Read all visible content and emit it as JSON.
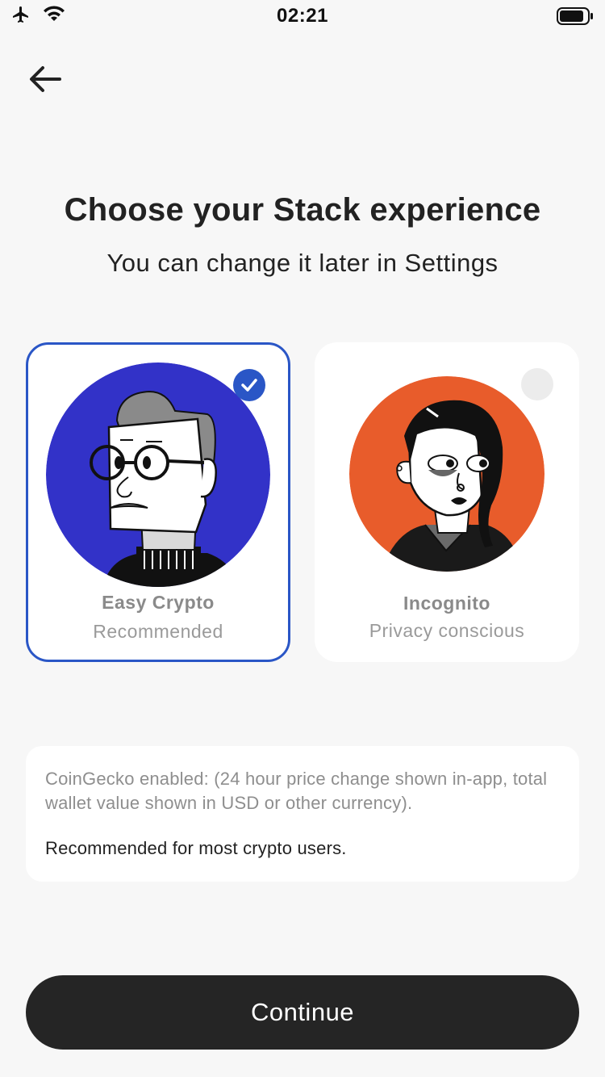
{
  "status_bar": {
    "time": "02:21",
    "icons": [
      "airplane-icon",
      "wifi-icon",
      "battery-icon"
    ]
  },
  "header": {
    "back_icon": "arrow-left-icon"
  },
  "main": {
    "title": "Choose your Stack experience",
    "subtitle": "You can change it later in Settings"
  },
  "options": [
    {
      "name": "Easy Crypto",
      "description": "Recommended",
      "selected": true,
      "avatar_color": "#3232c8"
    },
    {
      "name": "Incognito",
      "description": "Privacy conscious",
      "selected": false,
      "avatar_color": "#e85c2b"
    }
  ],
  "info": {
    "detail": "CoinGecko enabled: (24 hour price change shown in-app, total wallet value shown in USD or other currency).",
    "note": "Recommended for most crypto users."
  },
  "footer": {
    "continue_label": "Continue"
  },
  "colors": {
    "accent": "#2a56c6",
    "button_bg": "#252525",
    "background": "#f7f7f7"
  }
}
